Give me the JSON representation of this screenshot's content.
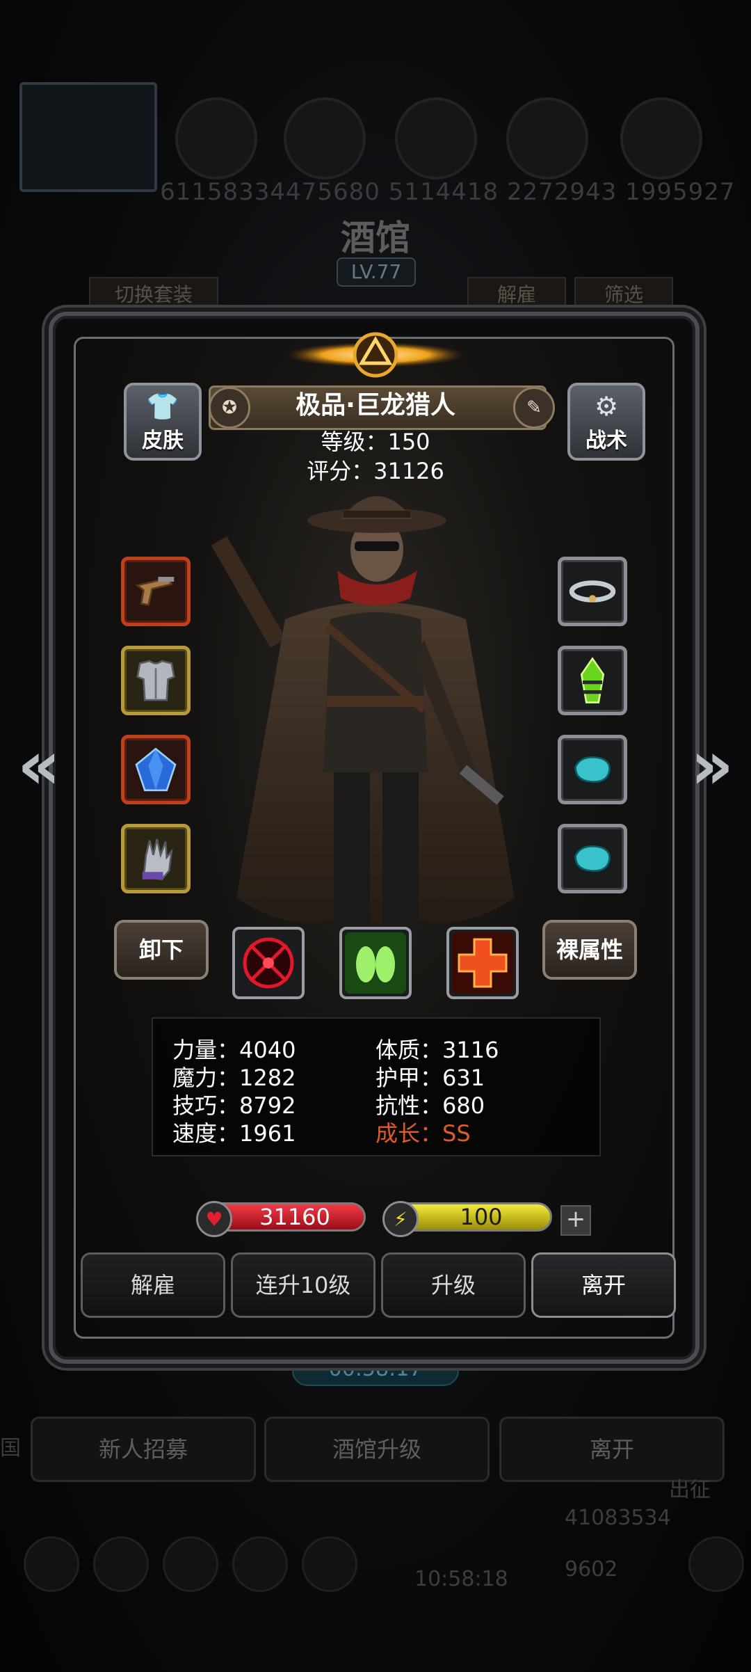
{
  "background": {
    "numbers_row": "61158334475680 5114418 2272943 1995927",
    "title": "酒馆",
    "level_badge": "LV.77",
    "tabs": {
      "switch_outfit": "切换套装",
      "dismiss": "解雇",
      "filter": "筛选"
    },
    "timer": "00:58:17",
    "buttons": {
      "recruit": "新人招募",
      "upgrade_tavern": "酒馆升级",
      "leave": "离开"
    },
    "side_left": "国",
    "side_right": "出征",
    "gold": "41083534",
    "gems": "9602",
    "clock": "10:58:18"
  },
  "hero": {
    "name": "极品·巨龙猎人",
    "level_text": "等级：150",
    "score_text": "评分：31126",
    "skin_label": "皮肤",
    "tactics_label": "战术"
  },
  "equipment": {
    "left": [
      {
        "name": "flintlock-pistol",
        "rarity": "red"
      },
      {
        "name": "steel-chest-armor",
        "rarity": "gold"
      },
      {
        "name": "blue-crystal",
        "rarity": "red"
      },
      {
        "name": "armored-gauntlet",
        "rarity": "gold"
      }
    ],
    "right": [
      {
        "name": "smoke-ring",
        "rarity": "grey"
      },
      {
        "name": "green-crystal-amulet",
        "rarity": "grey"
      },
      {
        "name": "teal-gem",
        "rarity": "grey"
      },
      {
        "name": "teal-gem",
        "rarity": "grey"
      }
    ]
  },
  "actions_row": {
    "unequip": "卸下",
    "base_attr": "裸属性"
  },
  "skills": [
    "crosshair-skill",
    "twin-shots-skill",
    "red-cross-skill"
  ],
  "stats": {
    "strength": "力量：4040",
    "magic": "魔力：1282",
    "skill": "技巧：8792",
    "speed": "速度：1961",
    "constitution": "体质：3116",
    "armor": "护甲：631",
    "resistance": "抗性：680",
    "growth": "成长：SS"
  },
  "bars": {
    "hp": "31160",
    "energy": "100",
    "energy_fill": 1.0
  },
  "buttons": {
    "dismiss": "解雇",
    "level_up_10": "连升10级",
    "upgrade": "升级",
    "leave": "离开"
  },
  "colors": {
    "growth": "#e05a2a",
    "hp": "#d21e2a",
    "energy": "#d6c81e"
  }
}
